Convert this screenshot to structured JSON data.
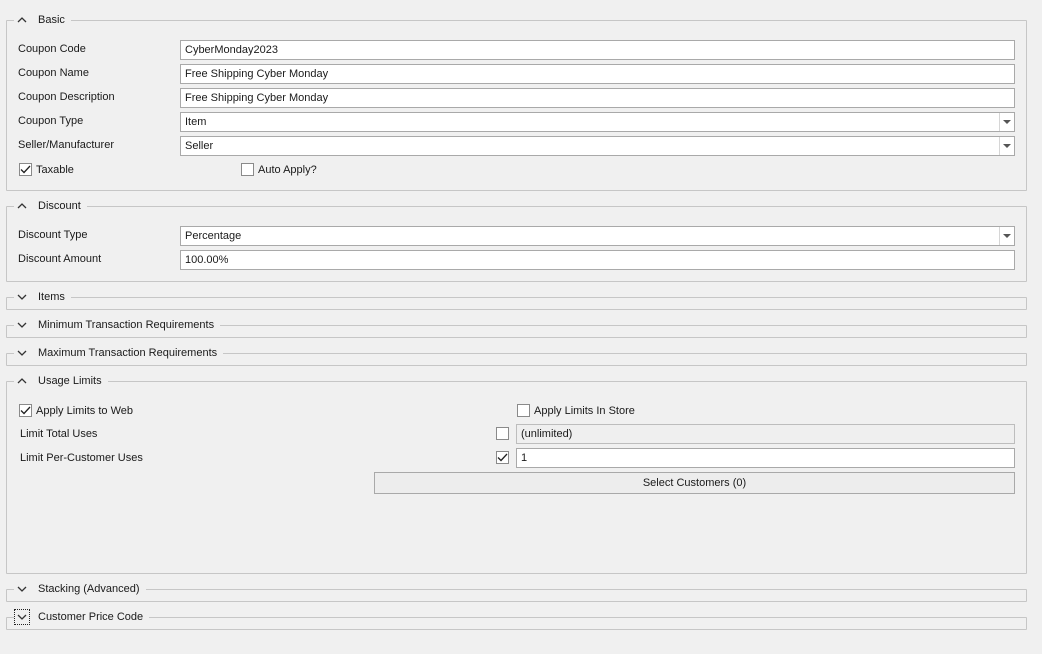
{
  "basic": {
    "title": "Basic",
    "coupon_code_label": "Coupon Code",
    "coupon_code_value": "CyberMonday2023",
    "coupon_name_label": "Coupon Name",
    "coupon_name_value": "Free Shipping Cyber Monday",
    "coupon_description_label": "Coupon Description",
    "coupon_description_value": "Free Shipping Cyber Monday",
    "coupon_type_label": "Coupon Type",
    "coupon_type_value": "Item",
    "seller_label": "Seller/Manufacturer",
    "seller_value": "Seller",
    "taxable_label": "Taxable",
    "taxable_checked": true,
    "auto_apply_label": "Auto Apply?",
    "auto_apply_checked": false
  },
  "discount": {
    "title": "Discount",
    "type_label": "Discount Type",
    "type_value": "Percentage",
    "amount_label": "Discount Amount",
    "amount_value": "100.00%"
  },
  "items": {
    "title": "Items"
  },
  "min_req": {
    "title": "Minimum Transaction Requirements"
  },
  "max_req": {
    "title": "Maximum Transaction Requirements"
  },
  "usage": {
    "title": "Usage Limits",
    "apply_web_label": "Apply Limits to Web",
    "apply_web_checked": true,
    "apply_store_label": "Apply Limits In Store",
    "apply_store_checked": false,
    "total_uses_label": "Limit Total Uses",
    "total_uses_checked": false,
    "total_uses_value": "(unlimited)",
    "per_customer_label": "Limit Per-Customer Uses",
    "per_customer_checked": true,
    "per_customer_value": "1",
    "select_customers_label": "Select Customers (0)"
  },
  "stacking": {
    "title": "Stacking (Advanced)"
  },
  "price_code": {
    "title": "Customer Price Code"
  },
  "icons": {
    "collapse": "chevron-up-icon",
    "expand": "chevron-down-icon",
    "dropdown": "dropdown-arrow-icon",
    "check": "checkmark-icon"
  }
}
